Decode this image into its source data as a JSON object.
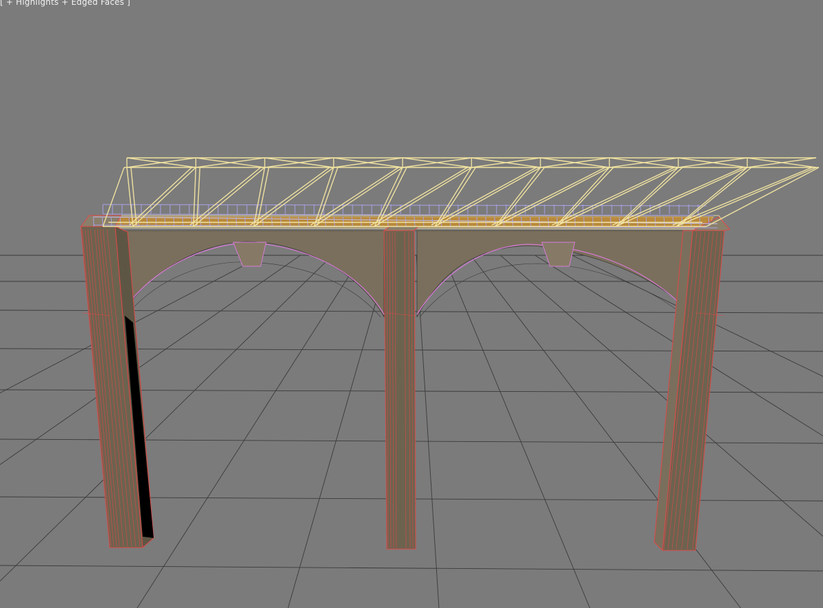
{
  "viewport": {
    "label": "[ + Highlights + Edged Faces ]",
    "colors": {
      "background": "#7b7b7b",
      "grid": "#3a3a3a",
      "stone_face": "#7a6f5c",
      "stone_side": "#6c634f",
      "stone_top": "#8a7f6b",
      "edge_selected": "#e04848",
      "arch_highlight": "#d87ad8",
      "truss": "#f0e2a0",
      "railing": "#a9a2e8",
      "deck": "#c7922e"
    }
  },
  "scene": {
    "object": "bridge-model",
    "parts": [
      "left-pier",
      "center-pier",
      "right-pier",
      "arch-wall",
      "keystone-left",
      "keystone-right",
      "deck",
      "railing",
      "truss"
    ]
  }
}
